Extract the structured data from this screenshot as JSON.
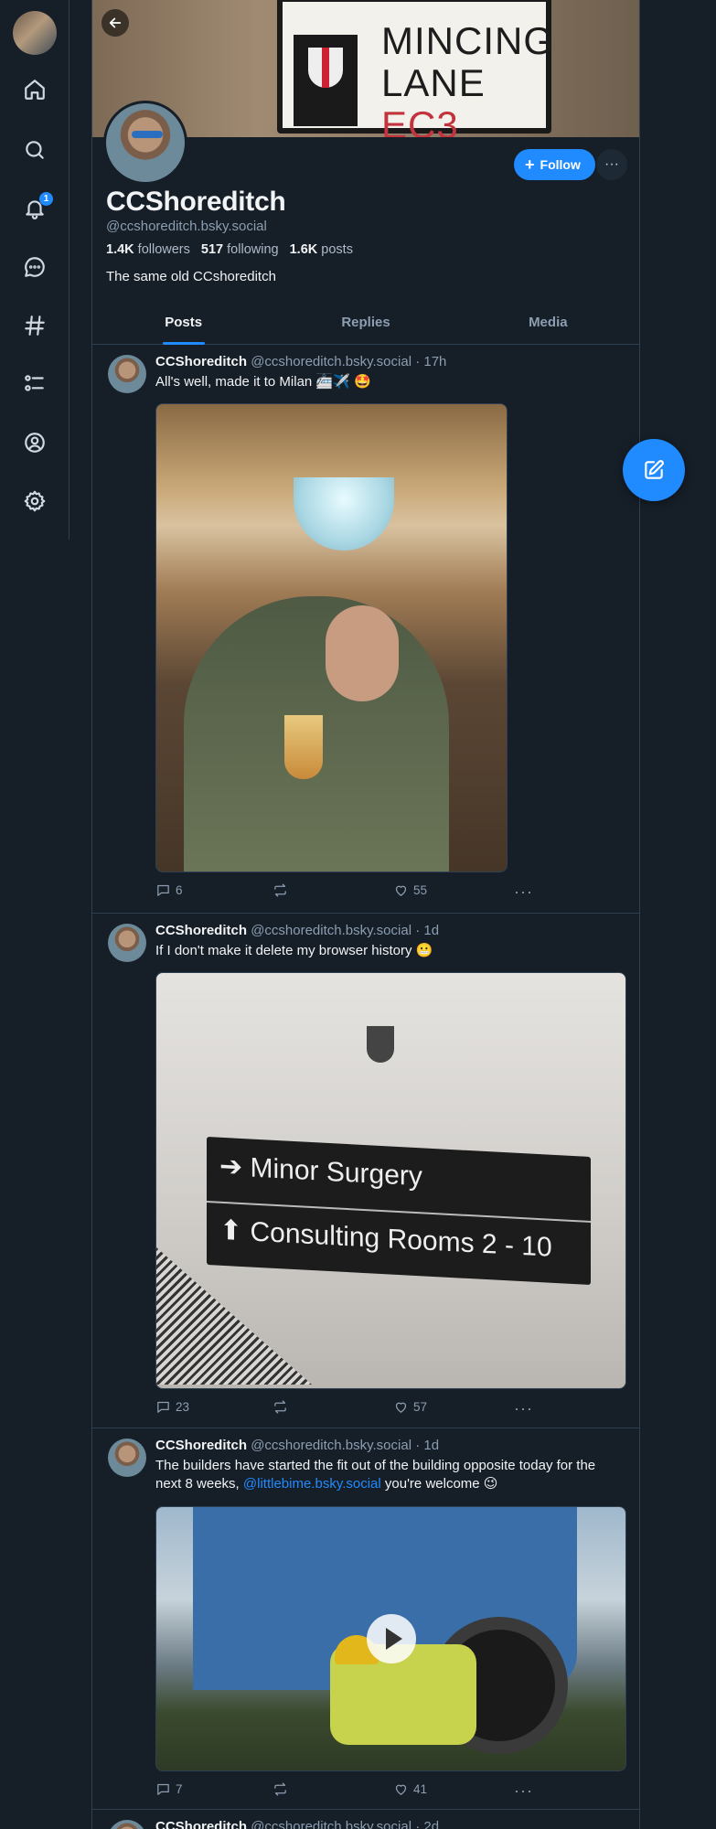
{
  "banner": {
    "sign_line1": "MINCING",
    "sign_line2": "LANE",
    "sign_code": "EC3",
    "sign_crest": "CITY OF LONDON"
  },
  "profile": {
    "display_name": "CCShoreditch",
    "handle": "@ccshoreditch.bsky.social",
    "followers_count": "1.4K",
    "followers_label": "followers",
    "following_count": "517",
    "following_label": "following",
    "posts_count": "1.6K",
    "posts_label": "posts",
    "bio": "The same old CCshoreditch",
    "follow_label": "Follow",
    "more_label": "···"
  },
  "nav": {
    "items": [
      "home-icon",
      "search-icon",
      "bell-icon",
      "chat-icon",
      "hash-icon",
      "list-icon",
      "profile-icon",
      "gear-icon"
    ],
    "notification_badge": "1"
  },
  "tabs": [
    {
      "label": "Posts",
      "active": true
    },
    {
      "label": "Replies",
      "active": false
    },
    {
      "label": "Media",
      "active": false
    }
  ],
  "posts": [
    {
      "name": "CCShoreditch",
      "meta": "@ccshoreditch.bsky.social · 17h",
      "text": "All's well, made it to Milan 🚈✈️ 🤩",
      "replies": "6",
      "reposts": "",
      "likes": "55",
      "media": "photo"
    },
    {
      "name": "CCShoreditch",
      "meta": "@ccshoreditch.bsky.social · 1d",
      "text": "If I don't make it delete my browser history 😬",
      "replies": "23",
      "reposts": "",
      "likes": "57",
      "media": "photo",
      "sign_line1": "Minor Surgery",
      "sign_line2": "Consulting Rooms 2 - 10"
    },
    {
      "name": "CCShoreditch",
      "meta": "@ccshoreditch.bsky.social · 1d",
      "text_before": "The builders have started the fit out of the building opposite today for the next 8 weeks, ",
      "mention": "@littlebime.bsky.social",
      "text_after": "  you're welcome 😉",
      "replies": "7",
      "reposts": "",
      "likes": "41",
      "media": "video"
    },
    {
      "name": "CCShoreditch",
      "meta": "@ccshoreditch.bsky.social · 2d"
    }
  ],
  "colors": {
    "accent": "#208bfe",
    "background": "#161e27",
    "border": "#2e4052",
    "muted": "#8c9eb2"
  }
}
